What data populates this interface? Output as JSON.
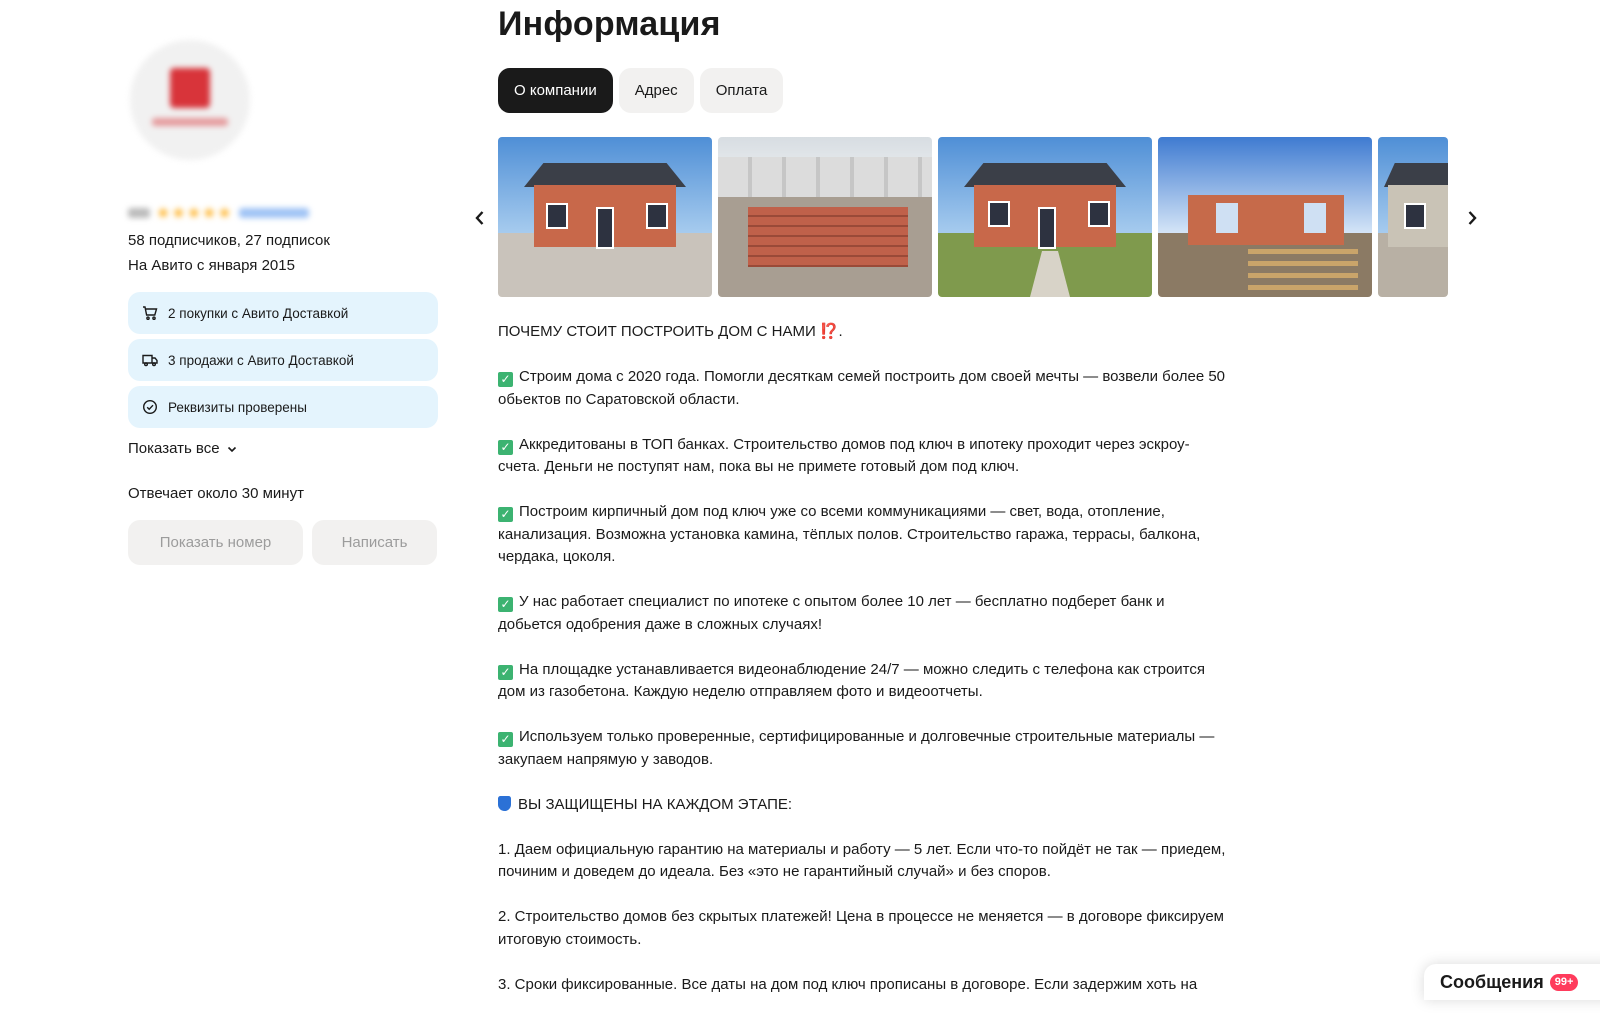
{
  "seller": {
    "subscribers": "58 подписчиков, 27 подписок",
    "since": "На Авито с января 2015",
    "badges": [
      {
        "icon": "cart-icon",
        "label": "2 покупки с Авито Доставкой"
      },
      {
        "icon": "truck-icon",
        "label": "3 продажи с Авито Доставкой"
      },
      {
        "icon": "check-circle-icon",
        "label": "Реквизиты проверены"
      }
    ],
    "show_all": "Показать все",
    "reply_time": "Отвечает около 30 минут",
    "show_phone_label": "Показать номер",
    "write_label": "Написать"
  },
  "main": {
    "title": "Информация",
    "tabs": [
      {
        "label": "О компании",
        "active": true
      },
      {
        "label": "Адрес",
        "active": false
      },
      {
        "label": "Оплата",
        "active": false
      }
    ],
    "photos_count_visible": 5,
    "description": {
      "heading": "ПОЧЕМУ СТОИТ ПОСТРОИТЬ ДОМ С НАМИ",
      "heading_emoji": "⁉️",
      "heading_tail": ".",
      "points": [
        "Строим дома с 2020 года. Помогли десяткам семей построить дом своей мечты — возвели более 50 обьектов по Саратовской области.",
        "Аккредитованы в ТОП банках. Строительство домов под ключ в ипотеку проходит через эскроу-счета. Деньги не поступят нам, пока вы не примете готовый дом под ключ.",
        "Построим кирпичный дом под ключ уже со всеми коммуникациями — свет, вода, отопление, канализация. Возможна установка камина, тёплых полов. Строительство гаража, террасы, балкона, чердака, цоколя.",
        "У нас работает специалист по ипотеке с опытом более 10 лет — бесплатно подберет банк и добьется одобрения даже в сложных случаях!",
        "На площадке устанавливается видеонаблюдение 24/7 — можно следить с телефона как строится дом из газобетона. Каждую неделю отправляем фото и видеоотчеты.",
        "Используем только проверенные, сертифицированные и долговечные строительные материалы — закупаем напрямую у заводов."
      ],
      "protected_heading": "ВЫ ЗАЩИЩЕНЫ НА КАЖДОМ ЭТАПЕ:",
      "numbered": [
        "1. Даем официальную гарантию на материалы и работу — 5 лет. Если что-то пойдёт не так — приедем, починим и доведем до идеала. Без «это не гарантийный случай» и без споров.",
        "2. Строительство домов без скрытых платежей! Цена в процессе не меняется — в договоре фиксируем итоговую стоимость.",
        "3. Сроки фиксированные. Все даты на дом под ключ прописаны в договоре. Если задержим хоть на"
      ]
    }
  },
  "messages": {
    "label": "Сообщения",
    "count": "99+"
  },
  "colors": {
    "badge_bg": "#e4f4fd",
    "tab_active_bg": "#1a1a1a",
    "tab_bg": "#f2f1f0",
    "check_green": "#3cb371",
    "counter_red": "#ff3b5c"
  }
}
